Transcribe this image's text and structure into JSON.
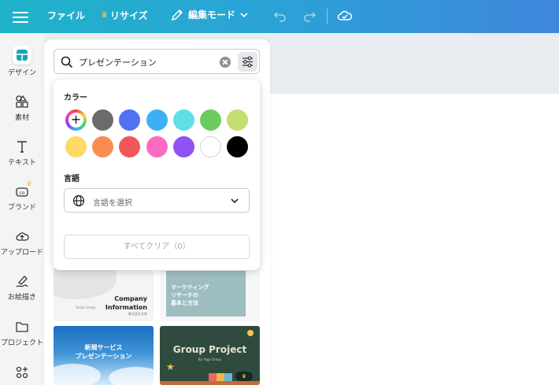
{
  "topbar": {
    "file_label": "ファイル",
    "resize_label": "リサイズ",
    "edit_mode_label": "編集モード"
  },
  "rail": {
    "items": [
      {
        "label": "デザイン",
        "icon": "design-icon"
      },
      {
        "label": "素材",
        "icon": "elements-icon"
      },
      {
        "label": "テキスト",
        "icon": "text-icon"
      },
      {
        "label": "ブランド",
        "icon": "brand-icon"
      },
      {
        "label": "アップロード",
        "icon": "upload-icon"
      },
      {
        "label": "お絵描き",
        "icon": "draw-icon"
      },
      {
        "label": "プロジェクト",
        "icon": "folder-icon"
      },
      {
        "label": "",
        "icon": "apps-icon"
      }
    ]
  },
  "search": {
    "value": "プレゼンテーション"
  },
  "filter_popup": {
    "color_heading": "カラー",
    "colors": [
      "#6b6b6b",
      "#5270f2",
      "#3ab1f5",
      "#5fdfe3",
      "#6ccb5f",
      "#c4de6f",
      "#ffd966",
      "#fa8c52",
      "#f35656",
      "#fb6bc0",
      "#8e52f5",
      "#ffffff",
      "#000000"
    ],
    "language_heading": "言語",
    "language_placeholder": "言語を選択",
    "clear_all_label": "すべてクリア（0）"
  },
  "templates": [
    {
      "title_line1": "Company",
      "title_line2": "Information",
      "subtitle": "株式会社名前",
      "footer": "Study Group"
    },
    {
      "title_line1": "マーケティング",
      "title_line2": "リサーチの",
      "title_line3": "基本と方法"
    },
    {
      "title_line1": "新規サービス",
      "title_line2": "プレゼンテーション"
    },
    {
      "title": "Group Project",
      "subtitle": "By Yoga Group"
    }
  ],
  "colors": {
    "topbar_start": "#1fb3c9",
    "topbar_end": "#3e86dc",
    "accent_crown": "#f7c948"
  }
}
